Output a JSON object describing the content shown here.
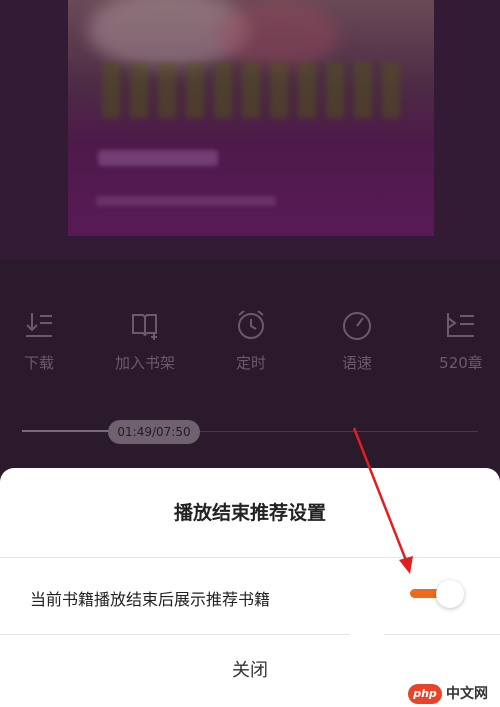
{
  "player": {
    "actions": [
      {
        "label": "下载",
        "icon": "download-icon"
      },
      {
        "label": "加入书架",
        "icon": "add-bookshelf-icon"
      },
      {
        "label": "定时",
        "icon": "alarm-clock-icon"
      },
      {
        "label": "语速",
        "icon": "speed-gauge-icon"
      },
      {
        "label": "520章",
        "icon": "chapter-list-icon"
      }
    ],
    "progress": {
      "time": "01:49/07:50",
      "fraction": 0.232
    }
  },
  "sheet": {
    "title": "播放结束推荐设置",
    "option_label": "当前书籍播放结束后展示推荐书籍",
    "toggle_on": true,
    "close_label": "关闭"
  },
  "watermark": {
    "logo": "php",
    "text": "中文网"
  },
  "colors": {
    "background": "#2a1a2c",
    "accent": "#f06a1e",
    "annotation_arrow": "#e02020",
    "muted_text": "#6c5a6c"
  }
}
